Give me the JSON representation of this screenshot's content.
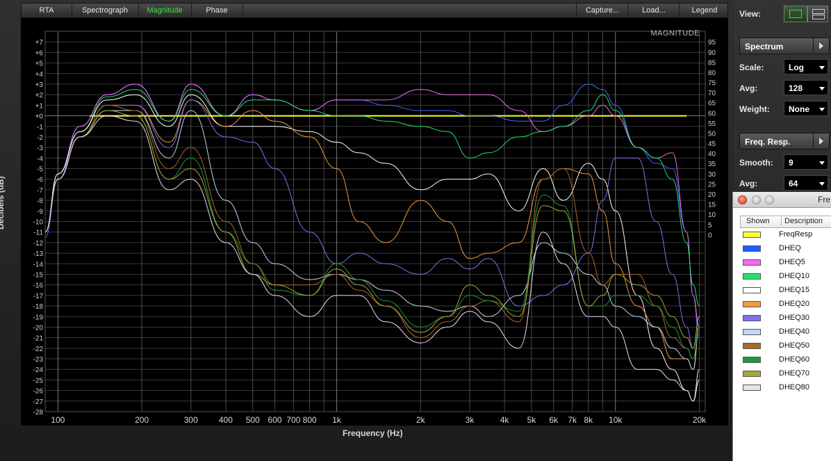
{
  "tabs": {
    "rta": "RTA",
    "spectrograph": "Spectrograph",
    "magnitude": "Magnitude",
    "phase": "Phase",
    "capture": "Capture...",
    "load": "Load...",
    "legend": "Legend"
  },
  "panel": {
    "view_label": "View:",
    "spectrum": "Spectrum",
    "scale_label": "Scale:",
    "scale_value": "Log",
    "avg_label": "Avg:",
    "avg_value": "128",
    "weight_label": "Weight:",
    "weight_value": "None",
    "freq_resp": "Freq. Resp.",
    "smooth_label": "Smooth:",
    "smooth_value": "9",
    "avg2_label": "Avg:",
    "avg2_value": "64"
  },
  "legend_window": {
    "title": "Fre",
    "col_shown": "Shown",
    "col_desc": "Description",
    "items": [
      {
        "name": "FreqResp",
        "color": "#ffff33"
      },
      {
        "name": "DHEQ",
        "color": "#1e5cff"
      },
      {
        "name": "DHEQ5",
        "color": "#f46af0"
      },
      {
        "name": "DHEQ10",
        "color": "#22e36a"
      },
      {
        "name": "DHEQ15",
        "color": "#ffffff"
      },
      {
        "name": "DHEQ20",
        "color": "#f59a3e"
      },
      {
        "name": "DHEQ30",
        "color": "#8070ee"
      },
      {
        "name": "DHEQ40",
        "color": "#c6d6ef"
      },
      {
        "name": "DHEQ50",
        "color": "#a86a2a"
      },
      {
        "name": "DHEQ60",
        "color": "#1d9a3a"
      },
      {
        "name": "DHEQ70",
        "color": "#a8a636"
      },
      {
        "name": "DHEQ80",
        "color": "#ece0f4"
      }
    ]
  },
  "chart_data": {
    "type": "line",
    "title": "MAGNITUDE",
    "xlabel": "Frequency (Hz)",
    "ylabel": "Decibels (dB)",
    "xscale": "log",
    "xlim": [
      90,
      21000
    ],
    "ylim": [
      -28,
      8
    ],
    "x_ticks": [
      {
        "v": 100,
        "label": "100"
      },
      {
        "v": 200,
        "label": "200"
      },
      {
        "v": 300,
        "label": "300"
      },
      {
        "v": 400,
        "label": "400"
      },
      {
        "v": 500,
        "label": "500"
      },
      {
        "v": 600,
        "label": "600"
      },
      {
        "v": 700,
        "label": "700"
      },
      {
        "v": 800,
        "label": "800"
      },
      {
        "v": 1000,
        "label": "1k"
      },
      {
        "v": 2000,
        "label": "2k"
      },
      {
        "v": 3000,
        "label": "3k"
      },
      {
        "v": 4000,
        "label": "4k"
      },
      {
        "v": 5000,
        "label": "5k"
      },
      {
        "v": 6000,
        "label": "6k"
      },
      {
        "v": 7000,
        "label": "7k"
      },
      {
        "v": 8000,
        "label": "8k"
      },
      {
        "v": 10000,
        "label": "10k"
      },
      {
        "v": 20000,
        "label": "20k"
      }
    ],
    "y_ticks": [
      "+7",
      "+6",
      "+5",
      "+4",
      "+3",
      "+2",
      "+1",
      "+0",
      "-1",
      "-2",
      "-3",
      "-4",
      "-5",
      "-6",
      "-7",
      "-8",
      "-9",
      "-10",
      "-11",
      "-12",
      "-13",
      "-14",
      "-15",
      "-16",
      "-17",
      "-18",
      "-19",
      "-20",
      "-21",
      "-22",
      "-23",
      "-24",
      "-25",
      "-26",
      "-27",
      "-28"
    ],
    "y2_ticks": [
      "95",
      "90",
      "85",
      "80",
      "75",
      "70",
      "65",
      "60",
      "55",
      "50",
      "45",
      "40",
      "35",
      "30",
      "25",
      "20",
      "15",
      "10",
      "5",
      "0"
    ],
    "grid": true,
    "legend": "separate window",
    "series": [
      {
        "name": "FreqResp",
        "color": "#ffff33",
        "x": [
          130,
          18000
        ],
        "y": [
          0,
          0
        ]
      },
      {
        "name": "DHEQ",
        "color": "#3d6bff",
        "x": [
          90,
          100,
          120,
          150,
          190,
          250,
          300,
          400,
          500,
          600,
          800,
          1000,
          1200,
          1500,
          2000,
          2500,
          3000,
          3500,
          4500,
          5500,
          6500,
          8000,
          9000,
          10000,
          12000,
          14000,
          16000,
          18000,
          19000,
          20000
        ],
        "y": [
          -11.5,
          -6,
          -1,
          2,
          3,
          -0.5,
          3,
          0,
          2,
          1.5,
          0.5,
          1.5,
          1.5,
          1,
          0.5,
          0.5,
          0,
          0,
          -0.5,
          -0.5,
          1,
          3,
          2.5,
          1,
          -3,
          -4.5,
          -5,
          -11,
          -17,
          -21
        ]
      },
      {
        "name": "DHEQ5",
        "color": "#f46af0",
        "x": [
          90,
          100,
          120,
          150,
          190,
          250,
          300,
          400,
          500,
          600,
          800,
          1000,
          1200,
          1500,
          2000,
          2500,
          3000,
          3500,
          4500,
          5500,
          6500,
          8000,
          9000,
          10000,
          12000,
          14000,
          16000,
          18000,
          19000,
          20000
        ],
        "y": [
          -11,
          -5.5,
          -1,
          2,
          3,
          -0.5,
          3,
          0,
          2,
          1.5,
          0.5,
          1.5,
          1.5,
          1.5,
          2.5,
          2,
          2,
          2,
          0.5,
          -1.5,
          -1,
          0,
          1,
          0,
          -3,
          -4,
          -3.5,
          -11,
          -17,
          -20
        ]
      },
      {
        "name": "DHEQ10",
        "color": "#22e36a",
        "x": [
          90,
          100,
          120,
          150,
          190,
          250,
          300,
          400,
          500,
          600,
          800,
          1000,
          1200,
          1500,
          2000,
          2500,
          3000,
          3500,
          4500,
          5500,
          6500,
          8000,
          9000,
          10000,
          12000,
          14000,
          16000,
          18000,
          19000,
          20000
        ],
        "y": [
          -11,
          -5.5,
          -1.5,
          1.8,
          2.5,
          -0.5,
          2.5,
          0,
          1.5,
          1.5,
          0.5,
          0,
          0,
          -0.5,
          -1,
          -1.5,
          -4,
          -3.5,
          -2,
          -1.5,
          -1,
          0.5,
          2,
          0.5,
          -3,
          -4,
          -6,
          -12,
          -16,
          -18
        ]
      },
      {
        "name": "DHEQ15",
        "color": "#ffffff",
        "x": [
          90,
          100,
          120,
          150,
          190,
          250,
          300,
          400,
          500,
          600,
          800,
          1000,
          1200,
          1500,
          2000,
          2500,
          3000,
          3500,
          4500,
          5500,
          6500,
          8000,
          9000,
          10000,
          12000,
          14000,
          16000,
          18000,
          19000,
          20000
        ],
        "y": [
          -11,
          -5.5,
          -1.5,
          1.5,
          2,
          -1,
          2,
          -1,
          -1,
          -1,
          -1.5,
          -2.5,
          -3.5,
          -4.5,
          -7,
          -6,
          -6,
          -5.5,
          -9,
          -5,
          -8,
          -4.5,
          -6,
          -9,
          -17,
          -22,
          -24,
          -26,
          -27,
          -25
        ]
      },
      {
        "name": "DHEQ20",
        "color": "#f59a3e",
        "x": [
          90,
          100,
          120,
          150,
          190,
          250,
          300,
          400,
          500,
          600,
          800,
          1000,
          1200,
          1500,
          2000,
          2500,
          3000,
          3500,
          4500,
          5500,
          6500,
          8000,
          9000,
          10000,
          12000,
          14000,
          16000,
          18000,
          19000,
          20000
        ],
        "y": [
          -11,
          -6,
          -2,
          1,
          1,
          -2.5,
          1.5,
          -1,
          0.5,
          -0.5,
          -2,
          -5,
          -10,
          -12,
          -8,
          -10,
          -13.5,
          -13,
          -12,
          -6,
          -5,
          -5.5,
          -9,
          -14,
          -18,
          -20,
          -23,
          -23,
          -24,
          -20
        ]
      },
      {
        "name": "DHEQ30",
        "color": "#8070ee",
        "x": [
          90,
          100,
          120,
          150,
          190,
          250,
          300,
          400,
          500,
          600,
          800,
          1000,
          1200,
          1500,
          2000,
          2500,
          3000,
          3500,
          4500,
          5500,
          6500,
          8000,
          9000,
          10000,
          12000,
          14000,
          16000,
          18000,
          19000,
          20000
        ],
        "y": [
          -11,
          -6,
          -2,
          1,
          1,
          -3,
          1.5,
          -2,
          -2.5,
          -5,
          -11,
          -14,
          -13,
          -14,
          -15,
          -13.5,
          -14.5,
          -13.5,
          -18,
          -17,
          -16,
          -13,
          -8,
          -4,
          -4,
          -10,
          -15,
          -20,
          -22,
          -19
        ]
      },
      {
        "name": "DHEQ40",
        "color": "#c6d6ef",
        "x": [
          90,
          100,
          120,
          150,
          190,
          250,
          300,
          400,
          500,
          600,
          800,
          1000,
          1200,
          1500,
          2000,
          2500,
          3000,
          3500,
          4500,
          5500,
          6500,
          8000,
          9000,
          10000,
          12000,
          14000,
          16000,
          18000,
          19000,
          20000
        ],
        "y": [
          -11,
          -6,
          -2,
          0.5,
          0.5,
          -4,
          0.5,
          -8,
          -12,
          -14,
          -15.5,
          -15,
          -15.5,
          -16.5,
          -18,
          -18.5,
          -18,
          -19,
          -17,
          -12,
          -13,
          -15,
          -16,
          -18,
          -19,
          -20,
          -22,
          -23,
          -24,
          -20
        ]
      },
      {
        "name": "DHEQ50",
        "color": "#a86a2a",
        "x": [
          90,
          100,
          120,
          150,
          190,
          250,
          300,
          400,
          500,
          600,
          800,
          1000,
          1200,
          1500,
          2000,
          2500,
          3000,
          3500,
          4500,
          5500,
          6500,
          8000,
          9000,
          10000,
          12000,
          14000,
          16000,
          18000,
          19000,
          20000
        ],
        "y": [
          -11,
          -6,
          -2,
          1,
          0.5,
          -5,
          -3,
          -10,
          -14,
          -16,
          -16,
          -15,
          -16.5,
          -18,
          -21,
          -19.5,
          -18,
          -17.5,
          -19.5,
          -6,
          -5,
          -13,
          -16,
          -15,
          -15,
          -18,
          -21,
          -22,
          -23,
          -20
        ]
      },
      {
        "name": "DHEQ60",
        "color": "#1d9a3a",
        "x": [
          90,
          100,
          120,
          150,
          190,
          250,
          300,
          400,
          500,
          600,
          800,
          1000,
          1200,
          1500,
          2000,
          2500,
          3000,
          3500,
          4500,
          5500,
          6500,
          8000,
          9000,
          10000,
          12000,
          14000,
          16000,
          18000,
          19000,
          20000
        ],
        "y": [
          -11,
          -6,
          -2,
          0.5,
          0,
          -6,
          -4,
          -11,
          -14,
          -16.5,
          -17,
          -14,
          -15.5,
          -17.5,
          -20,
          -19,
          -17,
          -17.5,
          -18.5,
          -7.5,
          -8.5,
          -18,
          -18,
          -17,
          -17,
          -18,
          -20,
          -22,
          -23,
          -20
        ]
      },
      {
        "name": "DHEQ70",
        "color": "#a8a636",
        "x": [
          90,
          100,
          120,
          150,
          190,
          250,
          300,
          400,
          500,
          600,
          800,
          1000,
          1200,
          1500,
          2000,
          2500,
          3000,
          3500,
          4500,
          5500,
          6500,
          8000,
          9000,
          10000,
          12000,
          14000,
          16000,
          18000,
          19000,
          20000
        ],
        "y": [
          -11,
          -6,
          -2,
          0.5,
          0,
          -6,
          -5,
          -11,
          -15,
          -16,
          -17,
          -14.5,
          -16,
          -18,
          -20.5,
          -19,
          -16,
          -17,
          -19,
          -8.5,
          -9,
          -18,
          -17,
          -15,
          -16,
          -17,
          -19,
          -21,
          -22,
          -19
        ]
      },
      {
        "name": "DHEQ80",
        "color": "#ece0f4",
        "x": [
          90,
          100,
          120,
          150,
          190,
          250,
          300,
          400,
          500,
          600,
          800,
          1000,
          1200,
          1500,
          2000,
          2500,
          3000,
          3500,
          4500,
          5500,
          6500,
          8000,
          9000,
          10000,
          12000,
          14000,
          16000,
          18000,
          19000,
          20000
        ],
        "y": [
          -11,
          -6,
          -2,
          0,
          -0.5,
          -7,
          -6,
          -12,
          -15,
          -17,
          -19,
          -17,
          -17,
          -19.5,
          -21.5,
          -20,
          -18.5,
          -19.5,
          -22,
          -11,
          -14,
          -19,
          -19,
          -20,
          -24,
          -24,
          -25,
          -26,
          -27,
          -24
        ]
      }
    ]
  }
}
